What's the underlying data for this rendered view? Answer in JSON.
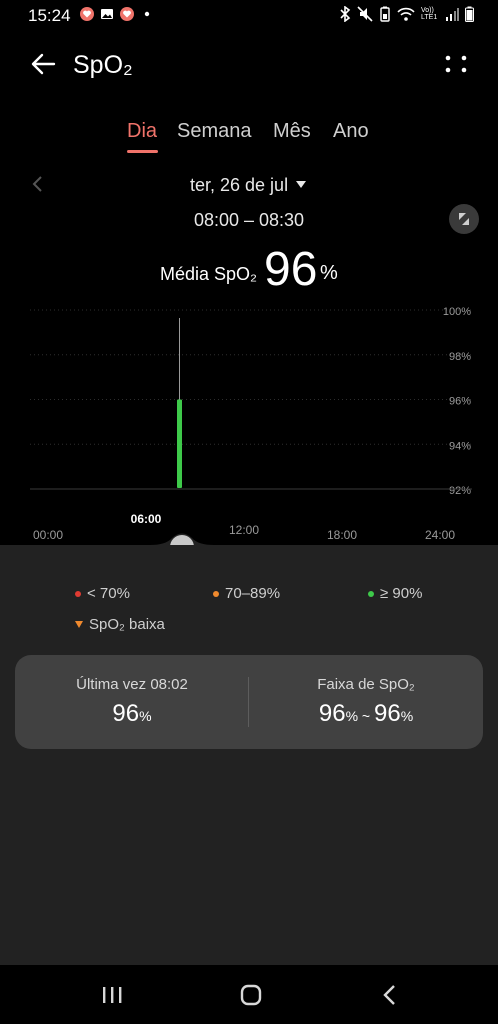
{
  "status_bar": {
    "time": "15:24",
    "network_label": "Vo)) LTE1"
  },
  "header": {
    "title": "SpO₂"
  },
  "tabs": [
    {
      "label": "Dia",
      "active": true
    },
    {
      "label": "Semana",
      "active": false
    },
    {
      "label": "Mês",
      "active": false
    },
    {
      "label": "Ano",
      "active": false
    }
  ],
  "date": {
    "label": "ter, 26 de jul",
    "time_range": "08:00 – 08:30"
  },
  "average": {
    "label": "Média SpO₂",
    "value": "96",
    "unit": "%"
  },
  "chart_data": {
    "type": "bar",
    "y_ticks": [
      "100%",
      "98%",
      "96%",
      "94%",
      "92%"
    ],
    "ylim": [
      91,
      100
    ],
    "x_ticks": [
      "00:00",
      "06:00",
      "12:00",
      "18:00",
      "24:00"
    ],
    "selected_x_label": "06:00",
    "series": [
      {
        "x": "08:00",
        "low": 91,
        "high": 96,
        "color": "#3ec94a"
      }
    ],
    "grid": true
  },
  "legend": [
    {
      "label": "< 70%",
      "color": "#e03b32",
      "marker": "dot"
    },
    {
      "label": "70–89%",
      "color": "#f08a2e",
      "marker": "dot"
    },
    {
      "label": "≥ 90%",
      "color": "#3ec94a",
      "marker": "dot"
    },
    {
      "label": "SpO₂ baixa",
      "color": "#f08a2e",
      "marker": "triangle"
    }
  ],
  "summary": {
    "last_label": "Última vez 08:02",
    "last_value": "96",
    "last_unit": "%",
    "range_label": "Faixa de SpO₂",
    "range_low": "96",
    "range_high": "96",
    "range_unit": "%",
    "range_sep": "~"
  },
  "colors": {
    "accent": "#f0736a",
    "background": "#000000",
    "panel": "#222222",
    "card": "#414141"
  }
}
